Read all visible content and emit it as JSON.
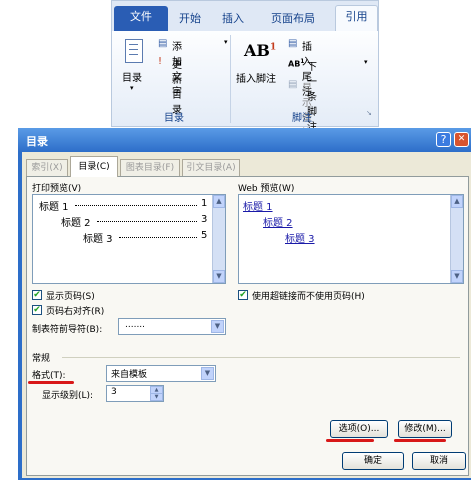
{
  "ribbon": {
    "tabs": [
      "文件",
      "开始",
      "插入",
      "页面布局",
      "引用"
    ],
    "toc_button": "目录",
    "add_text": "添加文字",
    "update_toc": "更新目录",
    "group_toc": "目录",
    "insert_footnote": "插入脚注",
    "insert_endnote": "插入尾注",
    "next_footnote": "下一条脚注",
    "show_notes": "显示备注",
    "group_footnote": "脚注",
    "ab_glyph": "AB",
    "ab_super": "1",
    "ab2_glyph": "AB",
    "ab2_super": "1"
  },
  "dialog": {
    "title": "目录",
    "help": "?",
    "close": "✕",
    "tabs": [
      "索引(X)",
      "目录(C)",
      "图表目录(F)",
      "引文目录(A)"
    ],
    "print_preview_label": "打印预览(V)",
    "web_preview_label": "Web 预览(W)",
    "print_preview": [
      {
        "text": "标题 1",
        "page": "1"
      },
      {
        "text": "标题 2",
        "page": "3"
      },
      {
        "text": "标题 3",
        "page": "5"
      }
    ],
    "web_preview": [
      "标题 1",
      "标题 2",
      "标题 3"
    ],
    "show_page_numbers": "显示页码(S)",
    "right_align": "页码右对齐(R)",
    "use_hyperlinks": "使用超链接而不使用页码(H)",
    "tab_leader_label": "制表符前导符(B):",
    "tab_leader_value": ".......",
    "general_label": "常规",
    "formats_label": "格式(T):",
    "formats_value": "来自模板",
    "levels_label": "显示级别(L):",
    "levels_value": "3",
    "options_button": "选项(O)...",
    "modify_button": "修改(M)...",
    "ok_button": "确定",
    "cancel_button": "取消"
  },
  "colors": {
    "accent": "#2d6ec9",
    "annotation": "#d81818",
    "link": "#1a1aa8"
  }
}
